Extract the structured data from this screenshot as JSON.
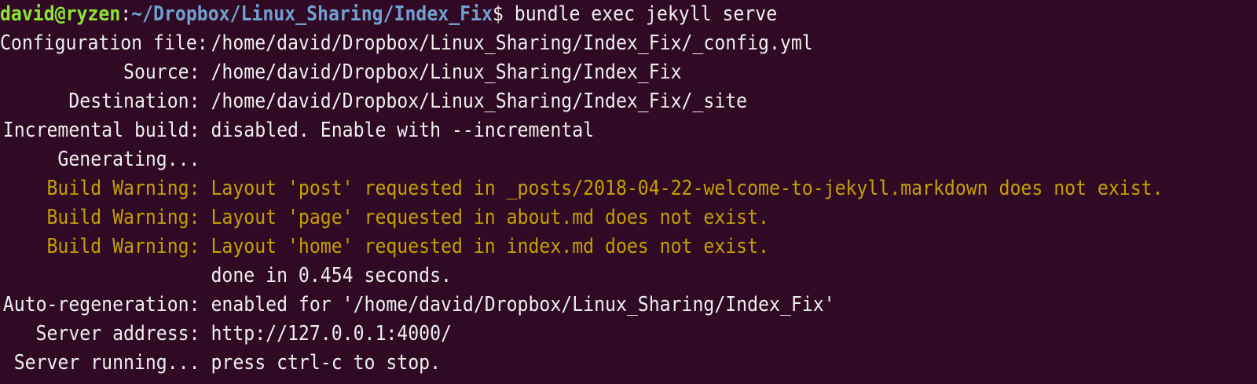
{
  "prompt": {
    "user_host": "david@ryzen",
    "path": "~/Dropbox/Linux_Sharing/Index_Fix",
    "symbol": "$",
    "command": " bundle exec jekyll serve"
  },
  "output": [
    {
      "label": "Configuration file:",
      "value": "/home/david/Dropbox/Linux_Sharing/Index_Fix/_config.yml",
      "kind": "info"
    },
    {
      "label": "Source:",
      "value": "/home/david/Dropbox/Linux_Sharing/Index_Fix",
      "kind": "info"
    },
    {
      "label": "Destination:",
      "value": "/home/david/Dropbox/Linux_Sharing/Index_Fix/_site",
      "kind": "info"
    },
    {
      "label": "Incremental build:",
      "value": "disabled. Enable with --incremental",
      "kind": "info"
    },
    {
      "label": "Generating...",
      "value": "",
      "kind": "info"
    },
    {
      "label": "Build Warning:",
      "value": "Layout 'post' requested in _posts/2018-04-22-welcome-to-jekyll.markdown does not exist.",
      "kind": "warn"
    },
    {
      "label": "Build Warning:",
      "value": "Layout 'page' requested in about.md does not exist.",
      "kind": "warn"
    },
    {
      "label": "Build Warning:",
      "value": "Layout 'home' requested in index.md does not exist.",
      "kind": "warn"
    },
    {
      "label": "",
      "value": "done in 0.454 seconds.",
      "kind": "info"
    },
    {
      "label": "Auto-regeneration:",
      "value": "enabled for '/home/david/Dropbox/Linux_Sharing/Index_Fix'",
      "kind": "info"
    },
    {
      "label": "Server address:",
      "value": "http://127.0.0.1:4000/",
      "kind": "info"
    },
    {
      "label": "Server running...",
      "value": "press ctrl-c to stop.",
      "kind": "info"
    }
  ]
}
